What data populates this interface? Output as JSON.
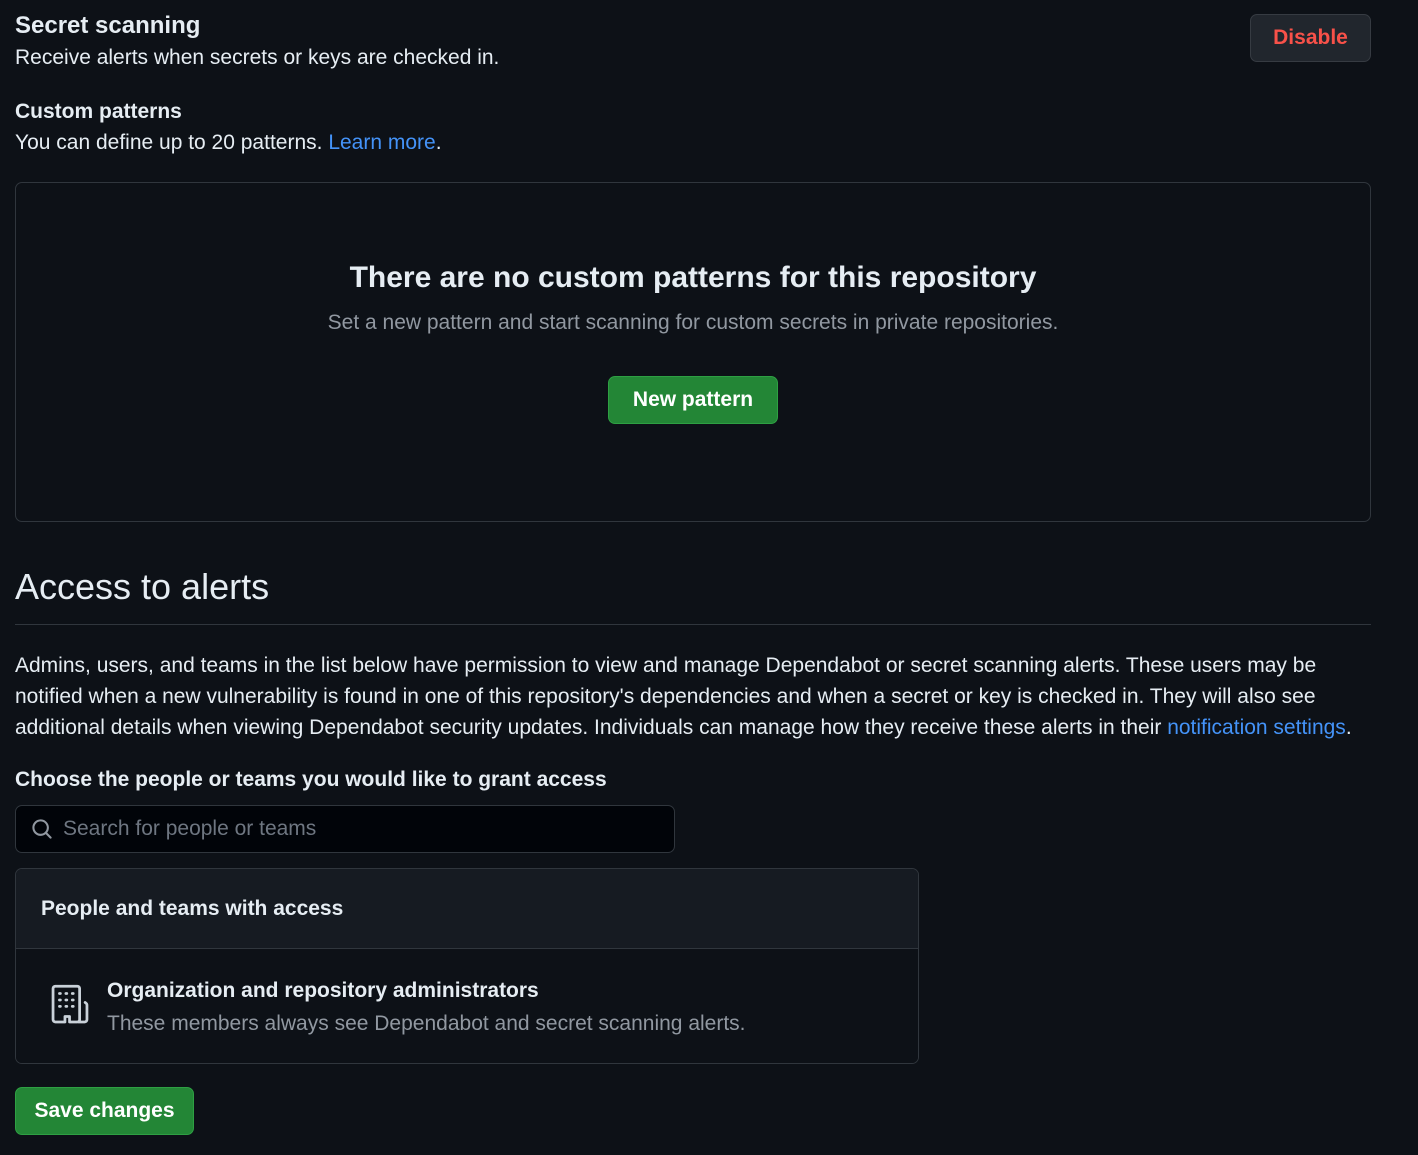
{
  "secret_scanning": {
    "title": "Secret scanning",
    "description": "Receive alerts when secrets or keys are checked in.",
    "disable_label": "Disable"
  },
  "custom_patterns": {
    "title": "Custom patterns",
    "description": "You can define up to 20 patterns.",
    "learn_more": "Learn more",
    "period": "."
  },
  "blankslate": {
    "heading": "There are no custom patterns for this repository",
    "description": "Set a new pattern and start scanning for custom secrets in private repositories.",
    "button_label": "New pattern"
  },
  "access": {
    "heading": "Access to alerts",
    "paragraph": "Admins, users, and teams in the list below have permission to view and manage Dependabot or secret scanning alerts. These users may be notified when a new vulnerability is found in one of this repository's dependencies and when a secret or key is checked in. They will also see additional details when viewing Dependabot security updates. Individuals can manage how they receive these alerts in their ",
    "notification_link": "notification settings",
    "period": ".",
    "choose_label": "Choose the people or teams you would like to grant access",
    "search_placeholder": "Search for people or teams",
    "search_value": "",
    "list_header": "People and teams with access",
    "entries": [
      {
        "icon": "organization-icon",
        "title": "Organization and repository administrators",
        "description": "These members always see Dependabot and secret scanning alerts."
      }
    ],
    "save_label": "Save changes"
  },
  "colors": {
    "background": "#0d1117",
    "border": "#30363d",
    "link": "#4493f8",
    "danger": "#f85149",
    "primary_button": "#238636",
    "muted_text": "#9198a1"
  }
}
